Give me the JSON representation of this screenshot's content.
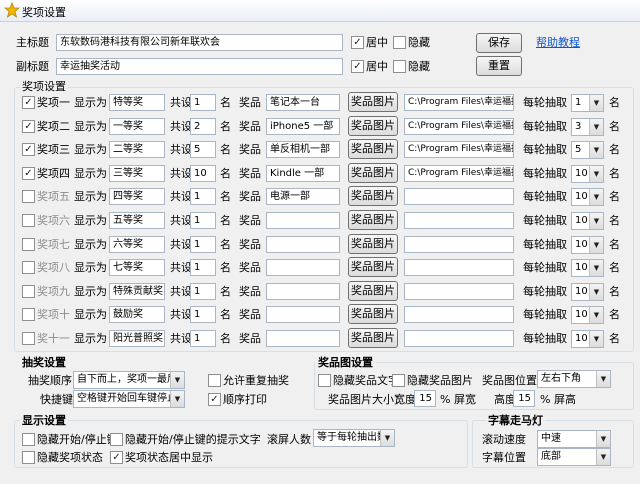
{
  "window": {
    "title": "奖项设置"
  },
  "main_title": {
    "label": "主标题",
    "value": "东软数码港科技有限公司新年联欢会",
    "center_label": "居中",
    "center_checked": true,
    "hide_label": "隐藏",
    "hide_checked": false
  },
  "sub_title": {
    "label": "副标题",
    "value": "幸运抽奖活动",
    "center_label": "居中",
    "center_checked": true,
    "hide_label": "隐藏",
    "hide_checked": false
  },
  "buttons": {
    "save": "保存",
    "reset": "重置",
    "help": "帮助教程"
  },
  "prizes_group": {
    "title": "奖项设置"
  },
  "row_labels": {
    "display_as": "显示为",
    "total": "共设",
    "unit": "名",
    "prize": "奖品",
    "prize_image": "奖品图片",
    "per_round": "每轮抽取"
  },
  "prizes": [
    {
      "enabled": true,
      "name": "奖项一",
      "display": "特等奖",
      "count": "1",
      "prize": "笔记本一台",
      "image": "C:\\Program Files\\幸运福抽奖\\",
      "per_round": "1"
    },
    {
      "enabled": true,
      "name": "奖项二",
      "display": "一等奖",
      "count": "2",
      "prize": "iPhone5 一部",
      "image": "C:\\Program Files\\幸运福抽奖\\",
      "per_round": "3"
    },
    {
      "enabled": true,
      "name": "奖项三",
      "display": "二等奖",
      "count": "5",
      "prize": "单反相机一部",
      "image": "C:\\Program Files\\幸运福抽奖\\",
      "per_round": "5"
    },
    {
      "enabled": true,
      "name": "奖项四",
      "display": "三等奖",
      "count": "10",
      "prize": "Kindle 一部",
      "image": "C:\\Program Files\\幸运福抽奖\\",
      "per_round": "10"
    },
    {
      "enabled": false,
      "name": "奖项五",
      "display": "四等奖",
      "count": "1",
      "prize": "电源一部",
      "image": "",
      "per_round": "10"
    },
    {
      "enabled": false,
      "name": "奖项六",
      "display": "五等奖",
      "count": "1",
      "prize": "",
      "image": "",
      "per_round": "10"
    },
    {
      "enabled": false,
      "name": "奖项七",
      "display": "六等奖",
      "count": "1",
      "prize": "",
      "image": "",
      "per_round": "10"
    },
    {
      "enabled": false,
      "name": "奖项八",
      "display": "七等奖",
      "count": "1",
      "prize": "",
      "image": "",
      "per_round": "10"
    },
    {
      "enabled": false,
      "name": "奖项九",
      "display": "特殊贡献奖",
      "count": "1",
      "prize": "",
      "image": "",
      "per_round": "10"
    },
    {
      "enabled": false,
      "name": "奖项十",
      "display": "鼓励奖",
      "count": "1",
      "prize": "",
      "image": "",
      "per_round": "10"
    },
    {
      "enabled": false,
      "name": "奖十一",
      "display": "阳光普照奖",
      "count": "1",
      "prize": "",
      "image": "",
      "per_round": "10"
    }
  ],
  "draw_settings": {
    "title": "抽奖设置",
    "order_label": "抽奖顺序",
    "order_value": "自下而上，奖项一最后",
    "allow_repeat_label": "允许重复抽奖",
    "allow_repeat_checked": false,
    "shortcut_label": "快捷键",
    "shortcut_value": "空格键开始回车键停止",
    "print_label": "顺序打印",
    "print_checked": true
  },
  "image_settings": {
    "title": "奖品图设置",
    "hide_text_label": "隐藏奖品文字",
    "hide_text_checked": false,
    "hide_image_label": "隐藏奖品图片",
    "hide_image_checked": false,
    "position_label": "奖品图位置",
    "position_value": "左右下角",
    "size_label": "奖品图片大小：",
    "width_label": "宽度",
    "width_value": "15",
    "width_unit": "% 屏宽",
    "height_label": "高度",
    "height_value": "15",
    "height_unit": "% 屏高"
  },
  "display_settings": {
    "title": "显示设置",
    "hide_start_stop_label": "隐藏开始/停止键",
    "hide_start_stop_checked": false,
    "hide_start_stop_hint_label": "隐藏开始/停止键的提示文字",
    "hide_start_stop_hint_checked": false,
    "scroll_label": "滚屏人数",
    "scroll_value": "等于每轮抽出数",
    "hide_status_label": "隐藏奖项状态",
    "hide_status_checked": false,
    "status_center_label": "奖项状态居中显示",
    "status_center_checked": true
  },
  "marquee": {
    "title": "字幕走马灯",
    "speed_label": "滚动速度",
    "speed_value": "中速",
    "position_label": "字幕位置",
    "position_value": "底部"
  },
  "check_mark": "✓",
  "combo_arrow": "▼",
  "icons": {
    "window": "star-icon"
  },
  "colors": {
    "accent": "#1155cc",
    "titlebar": "#e8eef7",
    "star": "#f2b600"
  }
}
